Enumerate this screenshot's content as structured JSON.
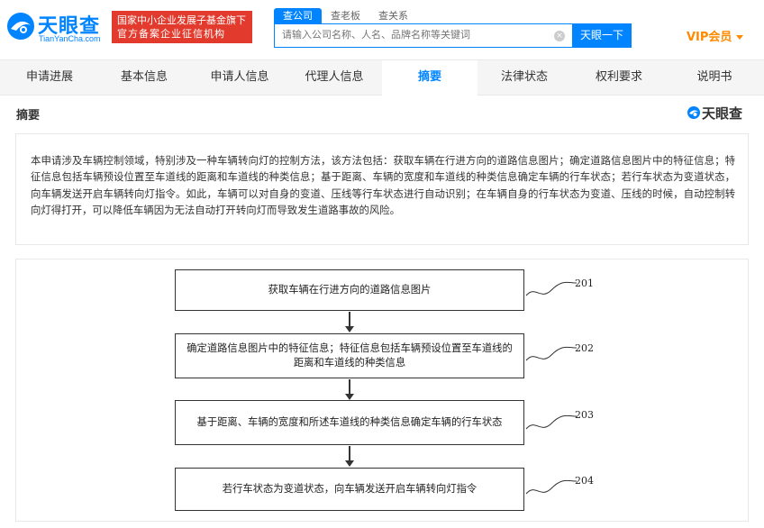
{
  "brand": {
    "name_cn": "天眼查",
    "name_en": "TianYanCha.com",
    "badge_line1": "国家中小企业发展子基金旗下",
    "badge_line2": "官方备案企业征信机构"
  },
  "search": {
    "tabs": [
      "查公司",
      "查老板",
      "查关系"
    ],
    "active_tab": "查公司",
    "placeholder": "请输入公司名称、人名、品牌名称等关键词",
    "button": "天眼一下"
  },
  "vip": {
    "label": "VIP会员"
  },
  "nav": {
    "items": [
      "申请进展",
      "基本信息",
      "申请人信息",
      "代理人信息",
      "摘要",
      "法律状态",
      "权利要求",
      "说明书"
    ],
    "active": "摘要"
  },
  "section": {
    "title": "摘要",
    "brand_right": "天眼查"
  },
  "abstract": {
    "text": "本申请涉及车辆控制领域，特别涉及一种车辆转向灯的控制方法，该方法包括：获取车辆在行进方向的道路信息图片；确定道路信息图片中的特征信息；特征信息包括车辆预设位置至车道线的距离和车道线的种类信息；基于距离、车辆的宽度和车道线的种类信息确定车辆的行车状态；若行车状态为变道状态，向车辆发送开启车辆转向灯指令。如此，车辆可以对自身的变道、压线等行车状态进行自动识别；在车辆自身的行车状态为变道、压线的时候，自动控制转向灯得打开，可以降低车辆因为无法自动打开转向灯而导致发生道路事故的风险。"
  },
  "figure": {
    "steps": [
      {
        "text": "获取车辆在行进方向的道路信息图片",
        "num": "201"
      },
      {
        "text": "确定道路信息图片中的特征信息；特征信息包括车辆预设位置至车道线的距离和车道线的种类信息",
        "num": "202"
      },
      {
        "text": "基于距离、车辆的宽度和所述车道线的种类信息确定车辆的行车状态",
        "num": "203"
      },
      {
        "text": "若行车状态为变道状态，向车辆发送开启车辆转向灯指令",
        "num": "204"
      }
    ]
  }
}
